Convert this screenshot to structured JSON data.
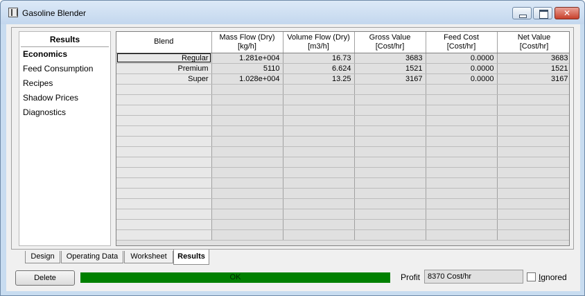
{
  "window": {
    "title": "Gasoline Blender"
  },
  "sidebar": {
    "title": "Results",
    "items": [
      {
        "label": "Economics",
        "active": true
      },
      {
        "label": "Feed Consumption",
        "active": false
      },
      {
        "label": "Recipes",
        "active": false
      },
      {
        "label": "Shadow Prices",
        "active": false
      },
      {
        "label": "Diagnostics",
        "active": false
      }
    ]
  },
  "table": {
    "headers": [
      {
        "line1": "Blend",
        "line2": ""
      },
      {
        "line1": "Mass Flow (Dry)",
        "line2": "[kg/h]"
      },
      {
        "line1": "Volume Flow (Dry)",
        "line2": "[m3/h]"
      },
      {
        "line1": "Gross Value",
        "line2": "[Cost/hr]"
      },
      {
        "line1": "Feed Cost",
        "line2": "[Cost/hr]"
      },
      {
        "line1": "Net Value",
        "line2": "[Cost/hr]"
      }
    ],
    "rows": [
      [
        "Regular",
        "1.281e+004",
        "16.73",
        "3683",
        "0.0000",
        "3683"
      ],
      [
        "Premium",
        "5110",
        "6.624",
        "1521",
        "0.0000",
        "1521"
      ],
      [
        "Super",
        "1.028e+004",
        "13.25",
        "3167",
        "0.0000",
        "3167"
      ]
    ]
  },
  "tabs": [
    {
      "label": "Design",
      "active": false
    },
    {
      "label": "Operating Data",
      "active": false
    },
    {
      "label": "Worksheet",
      "active": false
    },
    {
      "label": "Results",
      "active": true
    }
  ],
  "footer": {
    "delete_label": "Delete",
    "status_text": "OK",
    "status_color": "#008000",
    "profit_label": "Profit",
    "profit_value": "8370 Cost/hr",
    "ignored_label_first": "I",
    "ignored_label_rest": "gnored",
    "ignored_checked": false
  }
}
